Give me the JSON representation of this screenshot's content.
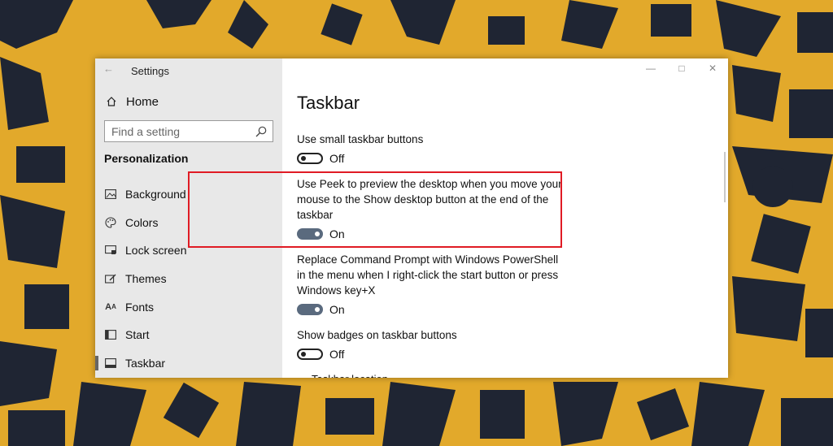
{
  "app": {
    "title": "Settings"
  },
  "sidebar": {
    "home_label": "Home",
    "search_placeholder": "Find a setting",
    "section_title": "Personalization",
    "items": [
      {
        "label": "Background",
        "icon": "image-icon"
      },
      {
        "label": "Colors",
        "icon": "palette-icon"
      },
      {
        "label": "Lock screen",
        "icon": "lock-screen-icon"
      },
      {
        "label": "Themes",
        "icon": "brush-icon"
      },
      {
        "label": "Fonts",
        "icon": "font-icon"
      },
      {
        "label": "Start",
        "icon": "start-icon"
      },
      {
        "label": "Taskbar",
        "icon": "taskbar-icon",
        "active": true
      }
    ]
  },
  "main": {
    "title": "Taskbar",
    "settings": [
      {
        "label": "Use small taskbar buttons",
        "state": "Off"
      },
      {
        "label": "Use Peek to preview the desktop when you move your mouse to the Show desktop button at the end of the taskbar",
        "state": "On"
      },
      {
        "label": "Replace Command Prompt with Windows PowerShell in the menu when I right-click the start button or press Windows key+X",
        "state": "On"
      },
      {
        "label": "Show badges on taskbar buttons",
        "state": "Off"
      }
    ],
    "cut_label": "Taskbar location"
  },
  "colors": {
    "highlight": "#e01b24",
    "toggle_on": "#5a6a7e",
    "wallpaper": "#e2a92b"
  }
}
